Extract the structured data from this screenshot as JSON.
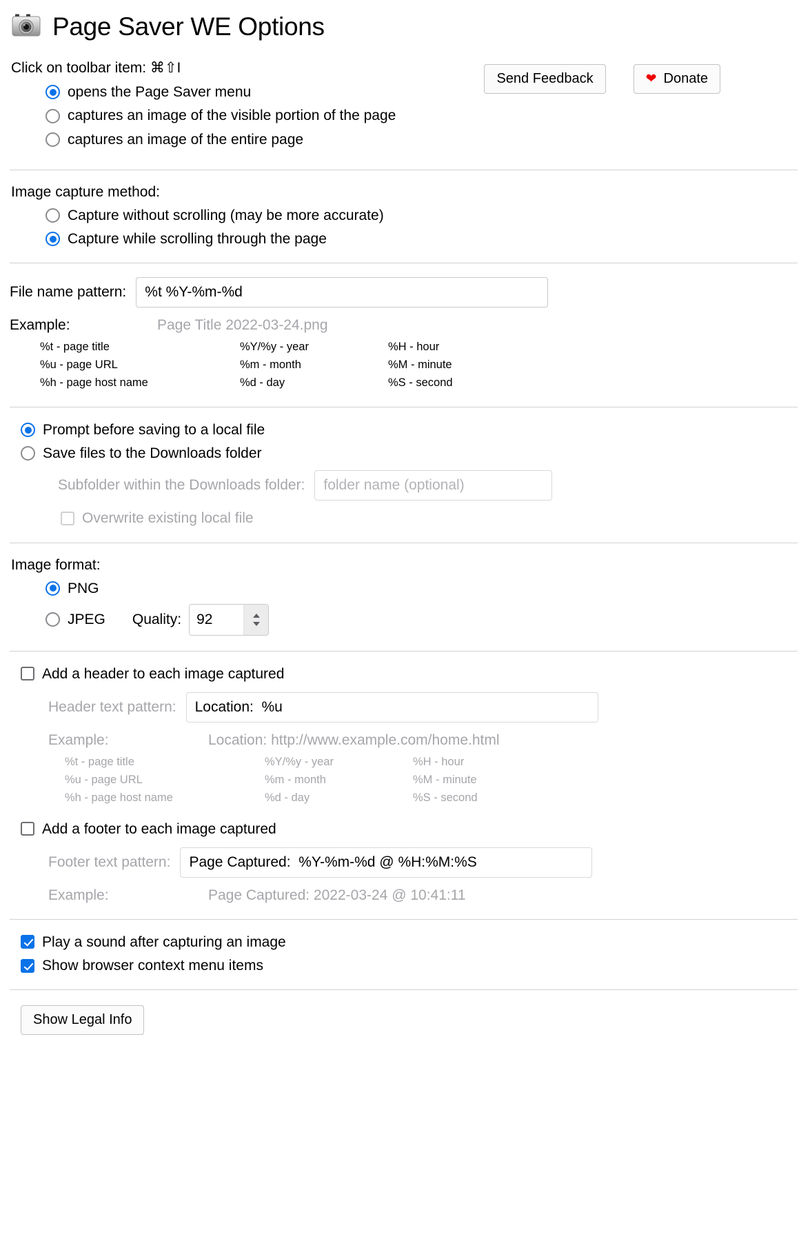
{
  "header": {
    "title": "Page Saver WE Options",
    "icon": "camera-icon"
  },
  "top": {
    "toolbar_prompt": "Click on toolbar item:",
    "shortcut": "⌘⇧I",
    "send_feedback_label": "Send Feedback",
    "donate_label": "Donate",
    "donate_icon": "heart-icon",
    "donate_heart_color": "#ee0000",
    "toolbar_options": [
      {
        "label": "opens the Page Saver menu",
        "selected": true
      },
      {
        "label": "captures an image of the visible portion of the page",
        "selected": false
      },
      {
        "label": "captures an image of the entire page",
        "selected": false
      }
    ]
  },
  "capture_method": {
    "heading": "Image capture method:",
    "options": [
      {
        "label": "Capture without scrolling (may be more accurate)",
        "selected": false
      },
      {
        "label": "Capture while scrolling through the page",
        "selected": true
      }
    ]
  },
  "filename": {
    "label": "File name pattern:",
    "value": "%t %Y-%m-%d",
    "example_label": "Example:",
    "example_value": "Page Title 2022-03-24.png",
    "tokens": [
      "%t - page title",
      "%Y/%y - year",
      "%H - hour",
      "%u - page URL",
      "%m - month",
      "%M - minute",
      "%h - page host name",
      "%d - day",
      "%S - second"
    ]
  },
  "saving": {
    "options": [
      {
        "label": "Prompt before saving to a local file",
        "selected": true
      },
      {
        "label": "Save files to the Downloads folder",
        "selected": false
      }
    ],
    "subfolder_label": "Subfolder within the Downloads folder:",
    "subfolder_value": "",
    "subfolder_placeholder": "folder name (optional)",
    "overwrite_label": "Overwrite existing local file",
    "overwrite_checked": false
  },
  "image_format": {
    "heading": "Image format:",
    "png_label": "PNG",
    "png_selected": true,
    "jpeg_label": "JPEG",
    "jpeg_selected": false,
    "quality_label": "Quality:",
    "quality_value": "92"
  },
  "header_overlay": {
    "checkbox_label": "Add a header to each image captured",
    "checked": false,
    "pattern_label": "Header text pattern:",
    "pattern_value": "Location:  %u",
    "example_label": "Example:",
    "example_value": "Location:  http://www.example.com/home.html",
    "tokens": [
      "%t - page title",
      "%Y/%y - year",
      "%H - hour",
      "%u - page URL",
      "%m - month",
      "%M - minute",
      "%h - page host name",
      "%d - day",
      "%S - second"
    ]
  },
  "footer_overlay": {
    "checkbox_label": "Add a footer to each image captured",
    "checked": false,
    "pattern_label": "Footer text pattern:",
    "pattern_value": "Page Captured:  %Y-%m-%d @ %H:%M:%S",
    "example_label": "Example:",
    "example_value": "Page Captured:  2022-03-24 @ 10:41:11"
  },
  "misc": {
    "sound_label": "Play a sound after capturing an image",
    "sound_checked": true,
    "context_menu_label": "Show browser context menu items",
    "context_menu_checked": true
  },
  "footer": {
    "legal_button_label": "Show Legal Info"
  },
  "colors": {
    "accent": "#0a72e8",
    "dim_text": "#a6a6ab",
    "divider": "#d2d2d2"
  }
}
